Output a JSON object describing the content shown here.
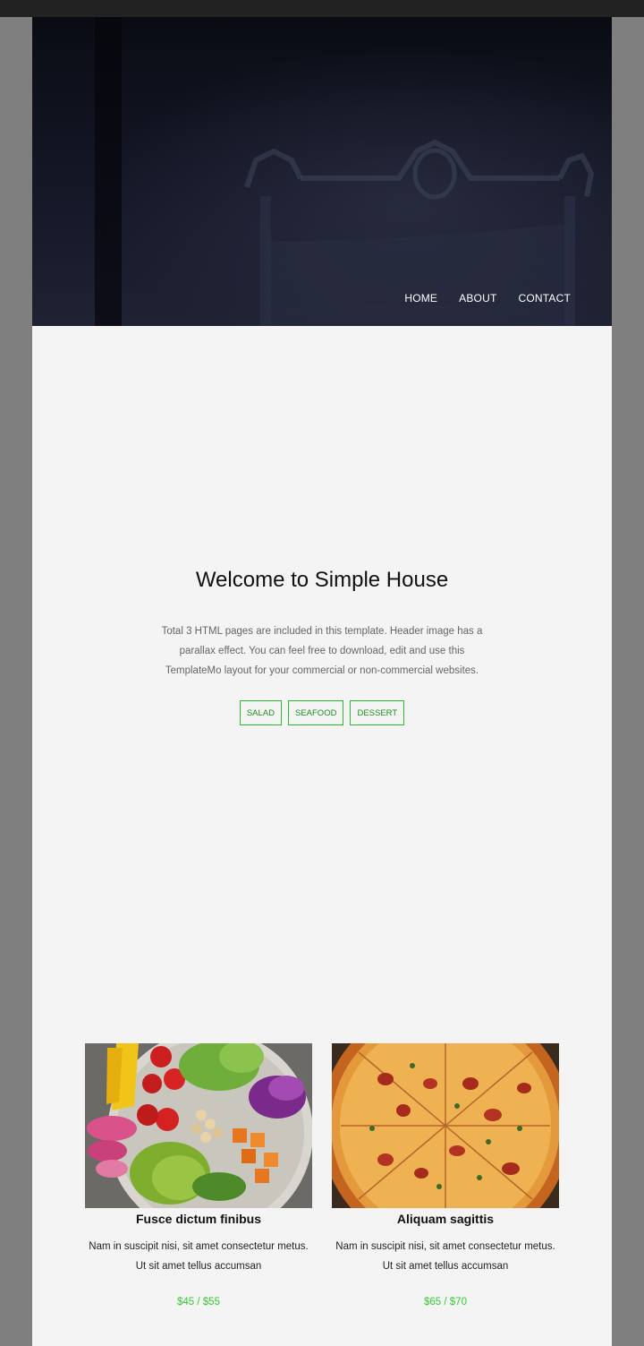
{
  "nav": {
    "items": [
      {
        "label": "HOME"
      },
      {
        "label": "ABOUT"
      },
      {
        "label": "CONTACT"
      }
    ]
  },
  "welcome": {
    "title": "Welcome to Simple House",
    "text": "Total 3 HTML pages are included in this template. Header image has a parallax effect. You can feel free to download, edit and use this TemplateMo layout for your commercial or non-commercial websites."
  },
  "tabs": [
    "SALAD",
    "SEAFOOD",
    "DESSERT"
  ],
  "cards": [
    {
      "image": "salad-bowl-image",
      "title": "Fusce dictum finibus",
      "desc": "Nam in suscipit nisi, sit amet consectetur metus. Ut sit amet tellus accumsan",
      "price": "$45 / $55"
    },
    {
      "image": "pizza-image",
      "title": "Aliquam sagittis",
      "desc": "Nam in suscipit nisi, sit amet consectetur metus. Ut sit amet tellus accumsan",
      "price": "$65 / $70"
    }
  ],
  "colors": {
    "accent": "#2eb82e",
    "price": "#35c935",
    "page_bg": "#f4f4f4",
    "outer_bg": "#7f7f7f"
  }
}
